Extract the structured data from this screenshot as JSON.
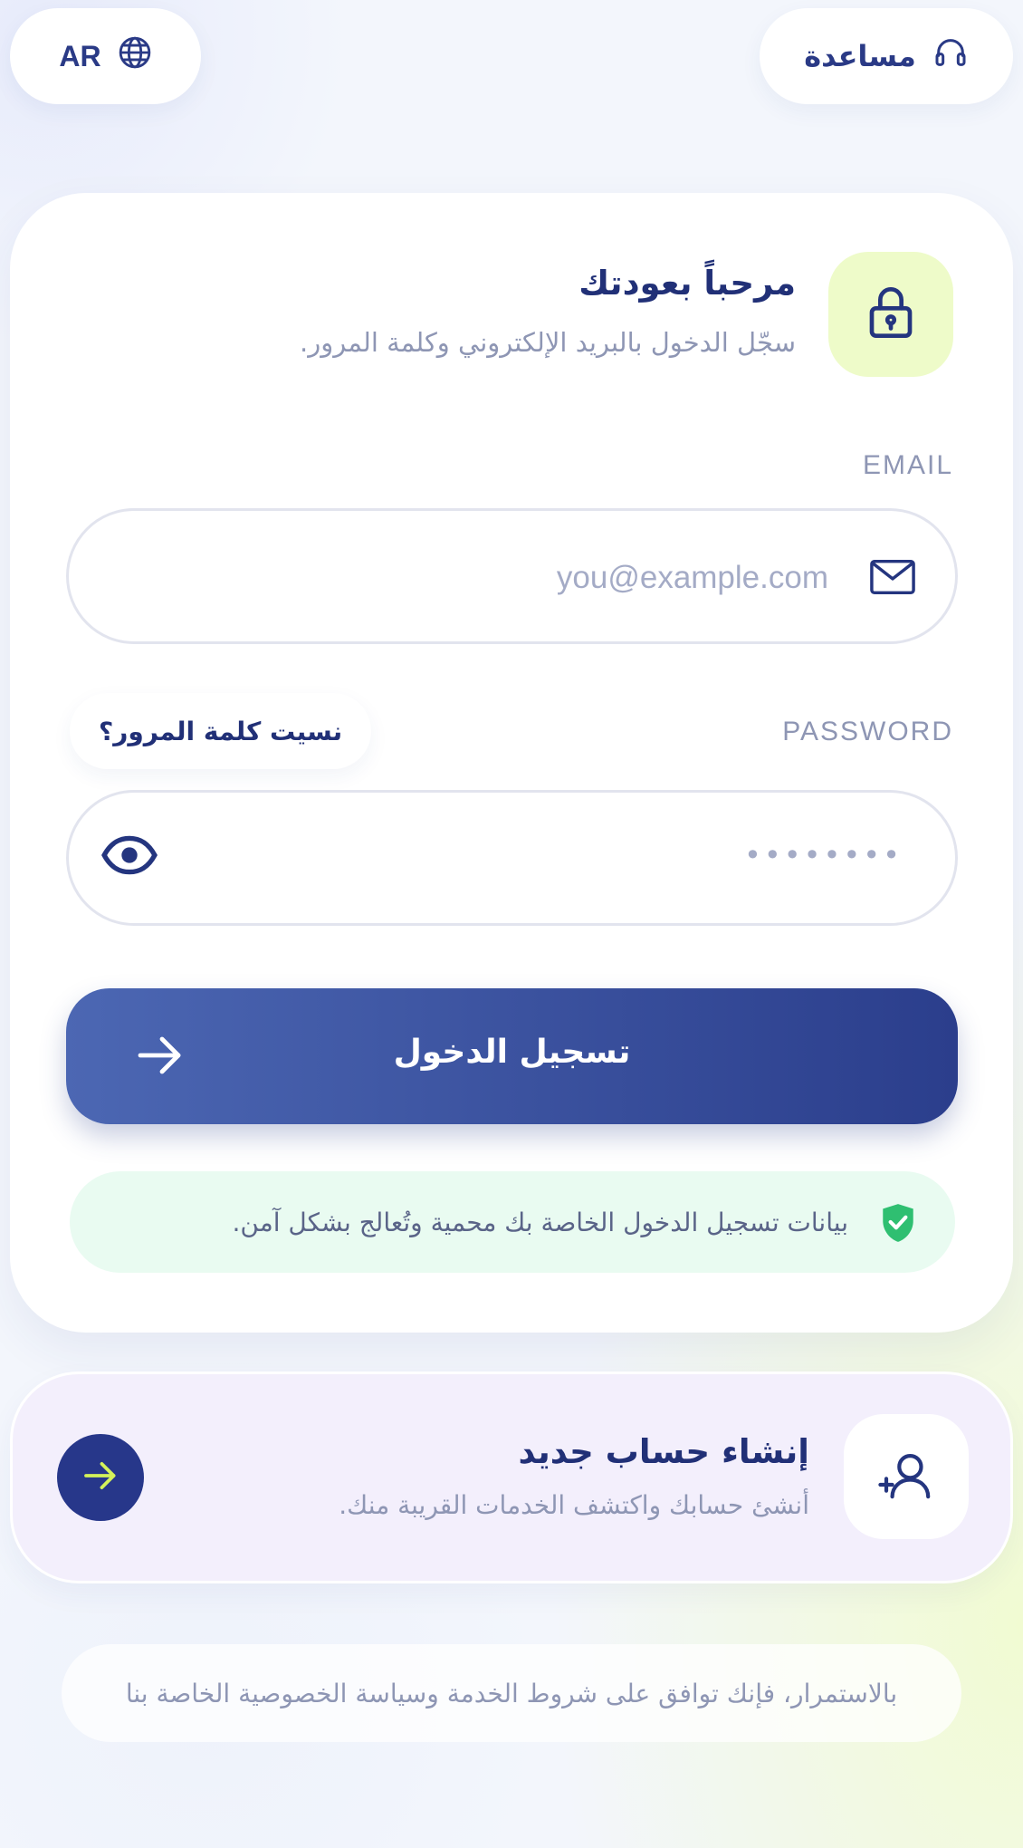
{
  "header": {
    "language_label": "AR",
    "help_label": "مساعدة"
  },
  "login": {
    "title": "مرحباً بعودتك",
    "subtitle": "سجّل الدخول بالبريد الإلكتروني وكلمة المرور.",
    "email_label": "EMAIL",
    "email_placeholder": "you@example.com",
    "password_label": "PASSWORD",
    "forgot_password": "نسيت كلمة المرور؟",
    "password_value": "••••••••",
    "submit_label": "تسجيل الدخول",
    "security_note": "بيانات تسجيل الدخول الخاصة بك محمية وتُعالج بشكل آمن."
  },
  "register": {
    "title": "إنشاء حساب جديد",
    "subtitle": "أنشئ حسابك واكتشف الخدمات القريبة منك."
  },
  "footer": {
    "terms": "بالاستمرار، فإنك توافق على شروط الخدمة وسياسة الخصوصية الخاصة بنا"
  },
  "colors": {
    "primary": "#27378a",
    "accent_lime": "#d4f25a",
    "secure_green": "#2fbf71",
    "muted_text": "#8e96b4"
  },
  "icons": {
    "language": "globe-icon",
    "help": "headset-icon",
    "lock": "lock-icon",
    "email": "mail-icon",
    "password_toggle": "eye-icon",
    "submit": "arrow-right-icon",
    "security": "shield-check-icon",
    "register": "add-user-icon",
    "register_go": "arrow-right-icon"
  }
}
